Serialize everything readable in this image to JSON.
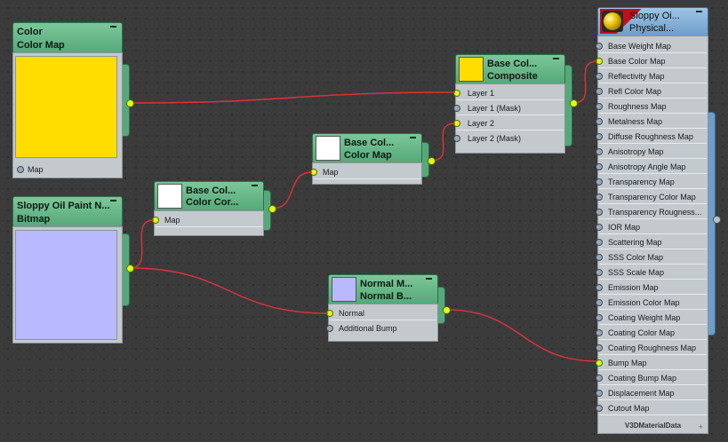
{
  "nodes": {
    "color_map": {
      "title": "Color",
      "subtitle": "Color Map",
      "slots": [
        "Map"
      ],
      "color": "#ffdd00"
    },
    "bitmap": {
      "title": "Sloppy Oil Paint N...",
      "subtitle": "Bitmap",
      "color": "#b9b9ff"
    },
    "color_correction": {
      "title": "Base Col...",
      "subtitle": "Color Cor...",
      "slots": [
        "Map"
      ],
      "color": "#ffffff"
    },
    "color_map2": {
      "title": "Base Col...",
      "subtitle": "Color Map",
      "slots": [
        "Map"
      ],
      "color": "#ffffff"
    },
    "composite": {
      "title": "Base Col...",
      "subtitle": "Composite",
      "slots": [
        "Layer 1",
        "Layer 1 (Mask)",
        "Layer 2",
        "Layer 2 (Mask)"
      ],
      "color": "#ffdd00"
    },
    "normal_bump": {
      "title": "Normal M...",
      "subtitle": "Normal B...",
      "slots": [
        "Normal",
        "Additional Bump"
      ],
      "color": "#b9b9ff"
    },
    "physical": {
      "title": "Sloppy Oi...",
      "subtitle": "Physical...",
      "footer": "V3DMaterialData",
      "slots": [
        "Base Weight Map",
        "Base Color Map",
        "Reflectivity Map",
        "Refl Color Map",
        "Roughness Map",
        "Metalness Map",
        "Diffuse Roughness Map",
        "Anisotropy Map",
        "Anisotropy Angle Map",
        "Transparency Map",
        "Transparency Color Map",
        "Transparency Rougness...",
        "IOR Map",
        "Scattering Map",
        "SSS Color Map",
        "SSS Scale Map",
        "Emission Map",
        "Emission Color Map",
        "Coating Weight Map",
        "Coating Color Map",
        "Coating Roughness Map",
        "Bump Map",
        "Coating Bump Map",
        "Displacement Map",
        "Cutout Map"
      ],
      "connected_slots": [
        "Base Color Map",
        "Bump Map"
      ]
    }
  },
  "colors": {
    "wire": "#e0323a",
    "port_active": "#d9ff1f",
    "node_green": "#56a87a",
    "node_blue": "#6f9ec8"
  }
}
